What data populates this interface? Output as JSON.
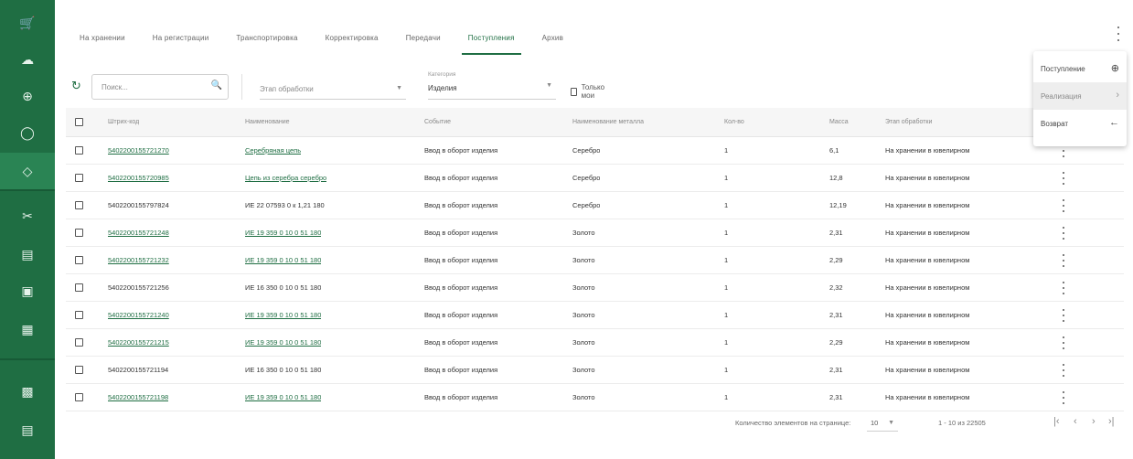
{
  "sidebar": {
    "items": [
      {
        "icon": "cart-icon",
        "glyph": "🛒"
      },
      {
        "icon": "cloud-icon",
        "glyph": "☁"
      },
      {
        "icon": "globe-icon",
        "glyph": "⊕"
      },
      {
        "icon": "ring-icon",
        "glyph": "◯"
      },
      {
        "icon": "diamond-icon",
        "glyph": "◇"
      },
      {
        "icon": "tools-icon",
        "glyph": "✂"
      },
      {
        "icon": "archive-icon",
        "glyph": "▤"
      },
      {
        "icon": "box-icon",
        "glyph": "▣"
      },
      {
        "icon": "report-icon",
        "glyph": "▦"
      },
      {
        "icon": "bag-icon",
        "glyph": "▩"
      },
      {
        "icon": "table-icon",
        "glyph": "▤"
      }
    ],
    "accent": "#1f6e43"
  },
  "tabs": [
    {
      "label": "На хранении",
      "active": false
    },
    {
      "label": "На регистрации",
      "active": false
    },
    {
      "label": "Транспортировка",
      "active": false
    },
    {
      "label": "Корректировка",
      "active": false
    },
    {
      "label": "Передачи",
      "active": false
    },
    {
      "label": "Поступления",
      "active": true
    },
    {
      "label": "Архив",
      "active": false
    }
  ],
  "toolbar": {
    "refresh_icon": "↻",
    "search_placeholder": "Поиск...",
    "search_icon": "🔍",
    "stage_placeholder": "Этап обработки",
    "category_label": "Категория",
    "category_value": "Изделия",
    "only_mine_label": "Только мои"
  },
  "table": {
    "headers": {
      "barcode": "Штрих-код",
      "name": "Наименование",
      "event": "Событие",
      "metal": "Наименование металла",
      "qty": "Кол-во",
      "mass": "Масса",
      "stage": "Этап обработки"
    },
    "rows": [
      {
        "barcode": "5402200155721270",
        "name": "Серебряная цепь",
        "event": "Ввод в оборот изделия",
        "metal": "Серебро",
        "qty": "1",
        "mass": "6,1",
        "stage": "На хранении в ювелирном"
      },
      {
        "barcode": "5402200155720985",
        "name": "Цепь из серебра серебро",
        "event": "Ввод в оборот изделия",
        "metal": "Серебро",
        "qty": "1",
        "mass": "12,8",
        "stage": "На хранении в ювелирном"
      },
      {
        "barcode": "5402200155797824",
        "name": "ИЕ 22 07593 0 к 1,21 180",
        "event": "Ввод в оборот изделия",
        "metal": "Серебро",
        "qty": "1",
        "mass": "12,19",
        "stage": "На хранении в ювелирном"
      },
      {
        "barcode": "5402200155721248",
        "name": "ИЕ 19 359 0 10 0 51 180",
        "event": "Ввод в оборот изделия",
        "metal": "Золото",
        "qty": "1",
        "mass": "2,31",
        "stage": "На хранении в ювелирном"
      },
      {
        "barcode": "5402200155721232",
        "name": "ИЕ 19 359 0 10 0 51 180",
        "event": "Ввод в оборот изделия",
        "metal": "Золото",
        "qty": "1",
        "mass": "2,29",
        "stage": "На хранении в ювелирном"
      },
      {
        "barcode": "5402200155721256",
        "name": "ИЕ 16 350 0 10 0 51 180",
        "event": "Ввод в оборот изделия",
        "metal": "Золото",
        "qty": "1",
        "mass": "2,32",
        "stage": "На хранении в ювелирном"
      },
      {
        "barcode": "5402200155721240",
        "name": "ИЕ 19 359 0 10 0 51 180",
        "event": "Ввод в оборот изделия",
        "metal": "Золото",
        "qty": "1",
        "mass": "2,31",
        "stage": "На хранении в ювелирном"
      },
      {
        "barcode": "5402200155721215",
        "name": "ИЕ 19 359 0 10 0 51 180",
        "event": "Ввод в оборот изделия",
        "metal": "Золото",
        "qty": "1",
        "mass": "2,29",
        "stage": "На хранении в ювелирном"
      },
      {
        "barcode": "5402200155721194",
        "name": "ИЕ 16 350 0 10 0 51 180",
        "event": "Ввод в оборот изделия",
        "metal": "Золото",
        "qty": "1",
        "mass": "2,31",
        "stage": "На хранении в ювелирном"
      },
      {
        "barcode": "5402200155721198",
        "name": "ИЕ 19 359 0 10 0 51 180",
        "event": "Ввод в оборот изделия",
        "metal": "Золото",
        "qty": "1",
        "mass": "2,31",
        "stage": "На хранении в ювелирном"
      }
    ]
  },
  "footer": {
    "rows_per_page_label": "Количество элементов на странице:",
    "rows_per_page_value": "10",
    "range": "1 - 10 из 22505",
    "first_icon": "|‹",
    "prev_icon": "‹",
    "next_icon": "›",
    "last_icon": "›|"
  },
  "dropdown": {
    "items": [
      {
        "label": "Поступление",
        "icon": "add-circle-icon",
        "glyph": "⊕"
      },
      {
        "label": "Реализация",
        "icon": "chevron-right-icon",
        "glyph": "›"
      },
      {
        "label": "Возврат",
        "icon": "arrow-left-icon",
        "glyph": "←"
      }
    ]
  }
}
